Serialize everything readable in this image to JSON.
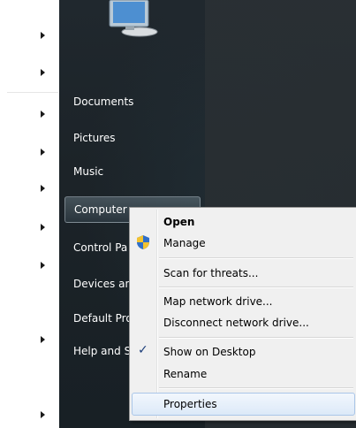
{
  "start_menu": {
    "right_items": [
      {
        "label": "Documents"
      },
      {
        "label": "Pictures"
      },
      {
        "label": "Music"
      },
      {
        "label": "Computer"
      },
      {
        "label": "Control Pa"
      },
      {
        "label": "Devices an"
      },
      {
        "label": "Default Pro"
      },
      {
        "label": "Help and S"
      }
    ]
  },
  "context_menu": {
    "items": {
      "open": "Open",
      "manage": "Manage",
      "scan": "Scan for threats...",
      "map_drive": "Map network drive...",
      "disconnect_drive": "Disconnect network drive...",
      "show_desktop": "Show on Desktop",
      "rename": "Rename",
      "properties": "Properties"
    },
    "check_glyph": "✓"
  }
}
